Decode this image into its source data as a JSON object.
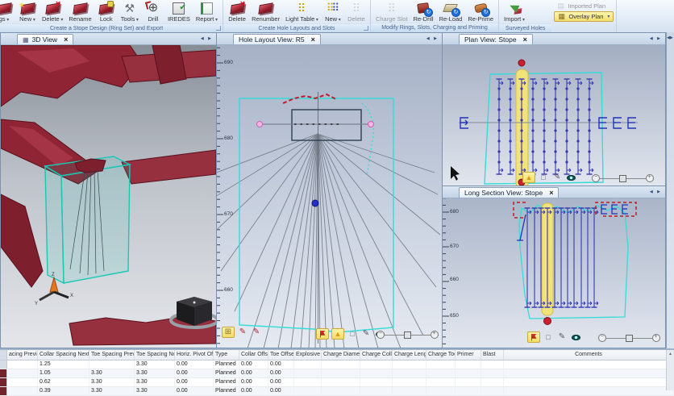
{
  "ribbon": {
    "groups": [
      {
        "caption": "Create a Stope Design (Ring Set) and Export",
        "buttons": [
          {
            "label": "gs",
            "icon": "stope",
            "dropdown": true
          },
          {
            "label": "New",
            "icon": "stope-star",
            "dropdown": true
          },
          {
            "label": "Delete",
            "icon": "stope-x",
            "dropdown": true
          },
          {
            "label": "Rename",
            "icon": "stope"
          },
          {
            "label": "Lock",
            "icon": "stope-lock"
          },
          {
            "label": "Tools",
            "icon": "tools",
            "dropdown": true
          },
          {
            "label": "Drill",
            "icon": "drill"
          },
          {
            "label": "IREDES",
            "icon": "iredes"
          },
          {
            "label": "Report",
            "icon": "report",
            "dropdown": true
          }
        ]
      },
      {
        "caption": "Create Hole Layouts and Slots",
        "buttons": [
          {
            "label": "Delete",
            "icon": "stope-x"
          },
          {
            "label": "Renumber",
            "icon": "stope"
          },
          {
            "label": "Light Table",
            "icon": "light-table",
            "dropdown": true
          },
          {
            "label": "New",
            "icon": "holes-new",
            "dropdown": true
          },
          {
            "label": "Delete",
            "icon": "holes-gray",
            "disabled": true
          }
        ]
      },
      {
        "caption": "Modify Rings, Slots, Charging and Priming",
        "buttons": [
          {
            "label": "Charge Slot",
            "icon": "charge-gray",
            "disabled": true
          },
          {
            "label": "Re-Drill",
            "icon": "redrill"
          },
          {
            "label": "Re-Load",
            "icon": "reload"
          },
          {
            "label": "Re-Prime",
            "icon": "reprime"
          }
        ]
      },
      {
        "caption": "Surveyed Holes",
        "buttons": [
          {
            "label": "Import",
            "icon": "import",
            "dropdown": true
          }
        ],
        "small_buttons": [
          {
            "label": "Imported Plan",
            "icon": "imported-plan",
            "disabled": true
          },
          {
            "label": "Overlay Plan",
            "icon": "overlay-plan",
            "highlighted": true,
            "dropdown": true
          }
        ]
      }
    ]
  },
  "panels": {
    "view3d": {
      "tab": "3D View"
    },
    "hole_layout": {
      "tab": "Hole Layout View: R5",
      "ruler": [
        "690",
        "680",
        "670",
        "660"
      ]
    },
    "plan": {
      "tab": "Plan View: Stope"
    },
    "long_section": {
      "tab": "Long Section View: Stope",
      "ruler": [
        "680",
        "670",
        "660",
        "650"
      ]
    }
  },
  "view_tools": {
    "mid_left": [
      {
        "icon": "overlay",
        "name": "overlay-toggle-icon",
        "highlighted": true
      },
      {
        "icon": "pencil-red",
        "name": "markup-icon"
      },
      {
        "icon": "pencil-red",
        "name": "sketch-icon"
      }
    ],
    "mid_right": [
      {
        "icon": "flag",
        "name": "flag-icon",
        "highlighted": true
      },
      {
        "icon": "cone",
        "name": "cone-icon",
        "highlighted": true
      },
      {
        "icon": "label",
        "name": "label-icon"
      },
      {
        "icon": "pencil",
        "name": "pencil-icon"
      },
      {
        "icon": "eye",
        "name": "visibility-icon"
      }
    ],
    "plan_right": [
      {
        "icon": "cone",
        "name": "cone-icon",
        "highlighted": true
      },
      {
        "icon": "label",
        "name": "label-icon"
      },
      {
        "icon": "pencil",
        "name": "pencil-icon"
      },
      {
        "icon": "eye",
        "name": "visibility-icon"
      }
    ],
    "long_right": [
      {
        "icon": "flag",
        "name": "flag-icon",
        "highlighted": true
      },
      {
        "icon": "label",
        "name": "label-icon"
      },
      {
        "icon": "pencil",
        "name": "pencil-icon"
      },
      {
        "icon": "eye",
        "name": "visibility-icon"
      }
    ]
  },
  "table": {
    "columns": [
      "acing Previous",
      "Collar Spacing Next",
      "Toe Spacing Previous",
      "Toe Spacing Next",
      "Horiz. Pivot Offset",
      "Type",
      "Collar Offset",
      "Toe Offset",
      "Explosive",
      "Charge Diameter",
      "Charge Collar",
      "Charge Length",
      "Charge Toe",
      "Primer",
      "Blast",
      "Comments"
    ],
    "rows": [
      [
        "",
        "1.25",
        "",
        "3.30",
        "0.00",
        "Planned",
        "0.00",
        "0.00",
        "",
        "",
        "",
        "",
        "",
        "",
        "",
        ""
      ],
      [
        "",
        "1.05",
        "3.30",
        "3.30",
        "0.00",
        "Planned",
        "0.00",
        "0.00",
        "",
        "",
        "",
        "",
        "",
        "",
        "",
        ""
      ],
      [
        "",
        "0.62",
        "3.30",
        "3.30",
        "0.00",
        "Planned",
        "0.00",
        "0.00",
        "",
        "",
        "",
        "",
        "",
        "",
        "",
        ""
      ],
      [
        "",
        "0.39",
        "3.30",
        "3.30",
        "0.00",
        "Planned",
        "0.00",
        "0.00",
        "",
        "",
        "",
        "",
        "",
        "",
        "",
        ""
      ]
    ]
  },
  "colors": {
    "accent_cyan": "#35dcd8",
    "ring_blue": "#3438b0",
    "highlight_yellow": "#f2e27a",
    "stope_red": "#8e2434",
    "marker_red": "#cc2030",
    "collar_pink": "#f2b7e4"
  }
}
